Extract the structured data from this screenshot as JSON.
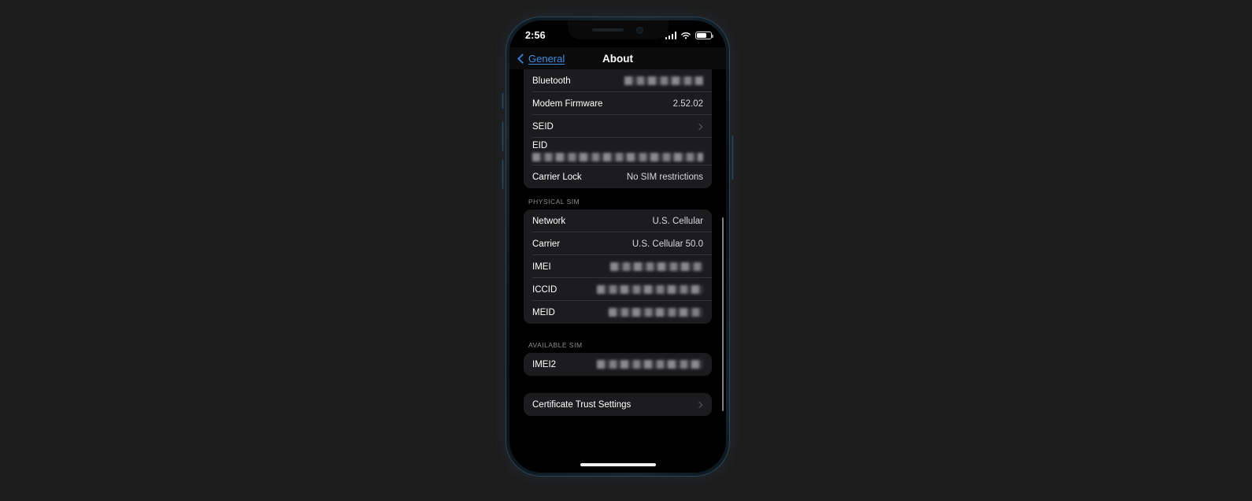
{
  "device": {
    "status_bar": {
      "time": "2:56",
      "cellular_icon": "signal-bars-icon",
      "wifi_icon": "wifi-icon",
      "battery_icon": "battery-icon",
      "battery_level_percent": 72
    },
    "home_indicator": "home-indicator"
  },
  "nav": {
    "back_label": "General",
    "back_icon": "chevron-left-icon",
    "title": "About"
  },
  "groups": [
    {
      "header": "",
      "rows": [
        {
          "label": "Bluetooth",
          "value": "",
          "redacted": true,
          "redaction_width": "wide",
          "type": "value"
        },
        {
          "label": "Modem Firmware",
          "value": "2.52.02",
          "redacted": false,
          "type": "value"
        },
        {
          "label": "SEID",
          "value": "",
          "redacted": false,
          "type": "disclosure"
        },
        {
          "label": "EID",
          "value": "",
          "redacted": true,
          "redaction_width": "full",
          "type": "stacked"
        },
        {
          "label": "Carrier Lock",
          "value": "No SIM restrictions",
          "redacted": false,
          "type": "value"
        }
      ]
    },
    {
      "header": "PHYSICAL SIM",
      "rows": [
        {
          "label": "Network",
          "value": "U.S. Cellular",
          "redacted": false,
          "type": "value"
        },
        {
          "label": "Carrier",
          "value": "U.S. Cellular 50.0",
          "redacted": false,
          "type": "value"
        },
        {
          "label": "IMEI",
          "value": "",
          "redacted": true,
          "redaction_width": "imei",
          "type": "value"
        },
        {
          "label": "ICCID",
          "value": "",
          "redacted": true,
          "redaction_width": "xwide",
          "type": "value"
        },
        {
          "label": "MEID",
          "value": "",
          "redacted": true,
          "redaction_width": "med",
          "type": "value"
        }
      ]
    },
    {
      "header": "AVAILABLE SIM",
      "rows": [
        {
          "label": "IMEI2",
          "value": "",
          "redacted": true,
          "redaction_width": "xwide",
          "type": "value"
        }
      ]
    },
    {
      "header": "",
      "rows": [
        {
          "label": "Certificate Trust Settings",
          "value": "",
          "redacted": false,
          "type": "disclosure"
        }
      ]
    }
  ],
  "colors": {
    "page_background": "#1d1d1d",
    "screen_background": "#000000",
    "card_background": "#1c1c1e",
    "accent_blue": "#3f8fe0",
    "primary_text": "#ffffff",
    "secondary_text": "#d8d8dc",
    "header_text": "#8d8d93"
  }
}
